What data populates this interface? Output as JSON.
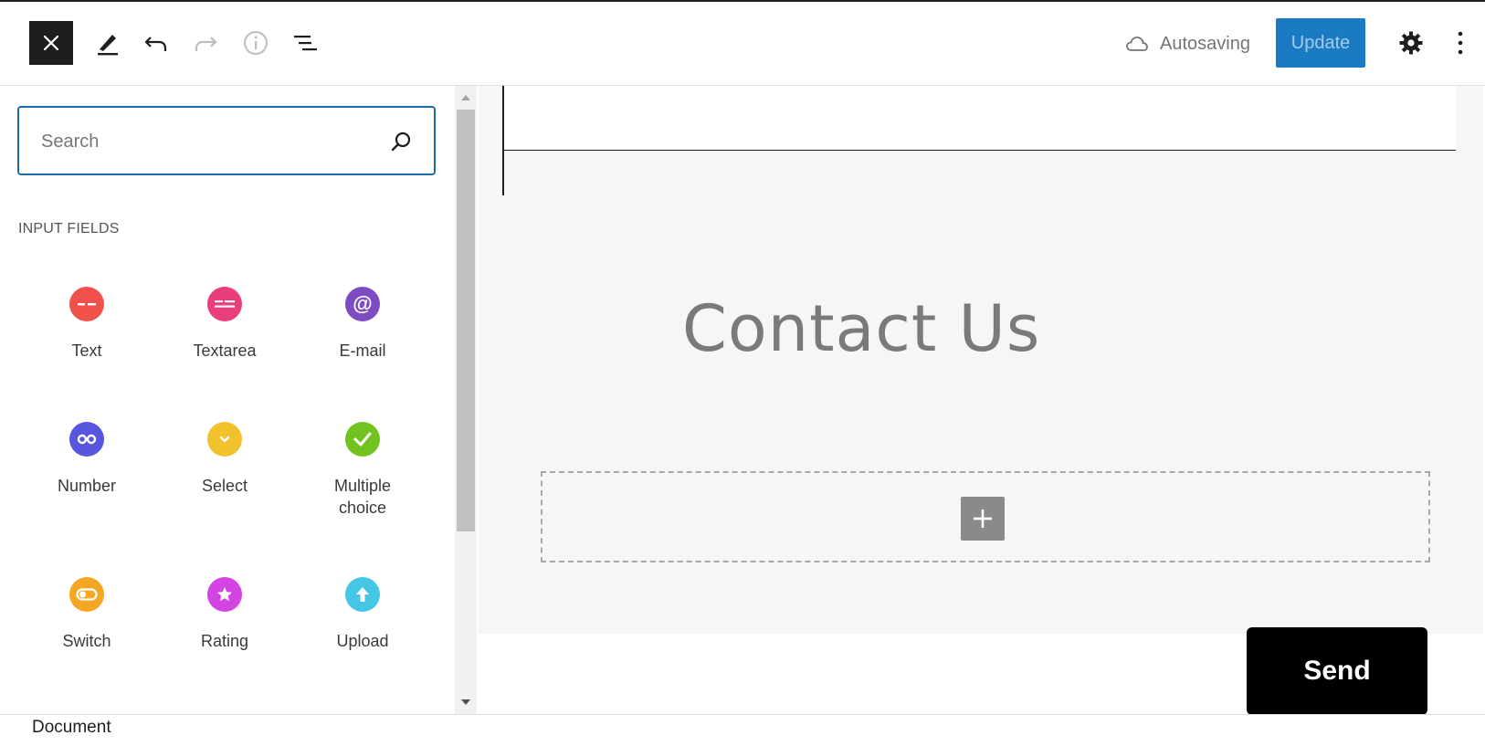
{
  "header": {
    "autosave_label": "Autosaving",
    "update_label": "Update",
    "accent_color": "#1a7bc4"
  },
  "sidebar": {
    "search": {
      "placeholder": "Search",
      "value": ""
    },
    "section_title": "INPUT FIELDS",
    "blocks": [
      {
        "label": "Text",
        "icon": "text-field-icon",
        "color": "#f0514b"
      },
      {
        "label": "Textarea",
        "icon": "textarea-field-icon",
        "color": "#ea3d7c"
      },
      {
        "label": "E-mail",
        "icon": "at-sign-icon",
        "color": "#7d4cc2"
      },
      {
        "label": "Number",
        "icon": "infinity-icon",
        "color": "#5856e0"
      },
      {
        "label": "Select",
        "icon": "chevron-down-icon",
        "color": "#f2c12e"
      },
      {
        "label": "Multiple choice",
        "icon": "checkmark-icon",
        "color": "#72c31f"
      },
      {
        "label": "Switch",
        "icon": "toggle-icon",
        "color": "#f5a623"
      },
      {
        "label": "Rating",
        "icon": "star-icon",
        "color": "#d444e3"
      },
      {
        "label": "Upload",
        "icon": "upload-arrow-icon",
        "color": "#44c6e4"
      }
    ]
  },
  "canvas": {
    "title": "Contact Us",
    "send_label": "Send"
  },
  "footer": {
    "breadcrumb": "Document"
  }
}
